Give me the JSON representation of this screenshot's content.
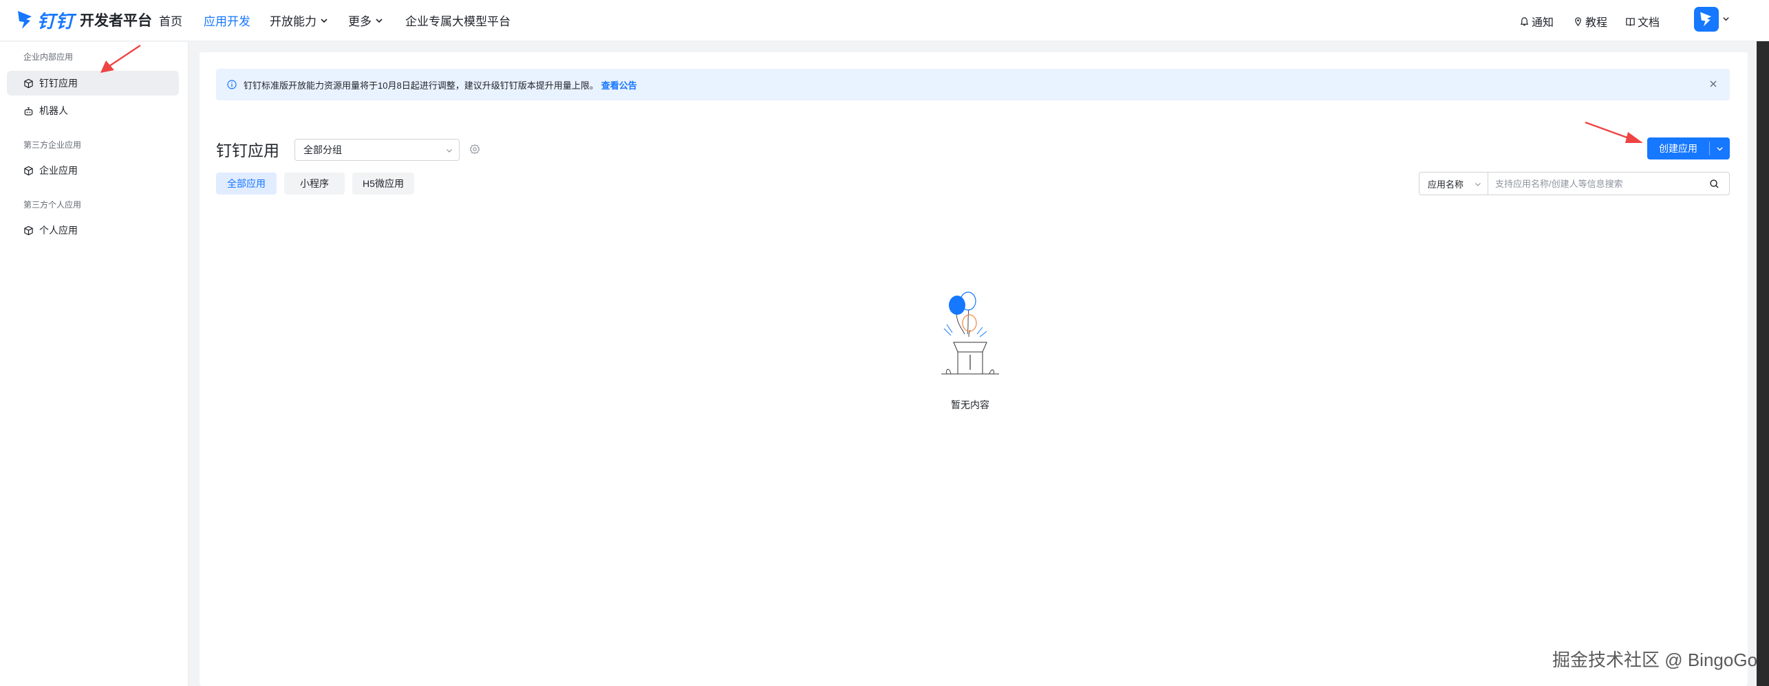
{
  "header": {
    "brand": "钉钉",
    "product": "开发者平台",
    "nav": [
      {
        "label": "首页",
        "dropdown": false
      },
      {
        "label": "应用开发",
        "dropdown": false,
        "active": true
      },
      {
        "label": "开放能力",
        "dropdown": true
      },
      {
        "label": "更多",
        "dropdown": true
      },
      {
        "label": "企业专属大模型平台",
        "dropdown": false
      }
    ],
    "actions": {
      "notify": "通知",
      "tutorial": "教程",
      "docs": "文档"
    }
  },
  "sidebar": {
    "groups": [
      {
        "title": "企业内部应用",
        "items": [
          {
            "label": "钉钉应用",
            "active": true
          },
          {
            "label": "机器人"
          }
        ]
      },
      {
        "title": "第三方企业应用",
        "items": [
          {
            "label": "企业应用"
          }
        ]
      },
      {
        "title": "第三方个人应用",
        "items": [
          {
            "label": "个人应用"
          }
        ]
      }
    ]
  },
  "notice": {
    "text": "钉钉标准版开放能力资源用量将于10月8日起进行调整，建议升级钉钉版本提升用量上限。",
    "link": "查看公告"
  },
  "main": {
    "title": "钉钉应用",
    "group_select": "全部分组",
    "create_button": "创建应用",
    "tabs": [
      {
        "label": "全部应用",
        "active": true
      },
      {
        "label": "小程序"
      },
      {
        "label": "H5微应用"
      }
    ],
    "search": {
      "type_label": "应用名称",
      "placeholder": "支持应用名称/创建人等信息搜索"
    },
    "empty_text": "暂无内容"
  },
  "watermark": "掘金技术社区 @ BingoGo",
  "colors": {
    "accent": "#1677ff",
    "notice_bg": "#e9f2ff",
    "arrow": "#ee4444"
  }
}
